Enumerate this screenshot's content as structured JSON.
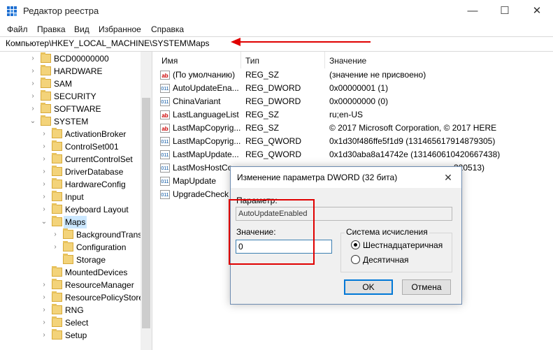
{
  "window": {
    "title": "Редактор реестра",
    "minimize": "—",
    "maximize": "☐",
    "close": "✕"
  },
  "menu": [
    "Файл",
    "Правка",
    "Вид",
    "Избранное",
    "Справка"
  ],
  "address": "Компьютер\\HKEY_LOCAL_MACHINE\\SYSTEM\\Maps",
  "colors": {
    "selection": "#cce8ff",
    "highlight": "#e00000",
    "folder": "#f3d37a"
  },
  "tree": [
    {
      "label": "BCD00000000"
    },
    {
      "label": "HARDWARE"
    },
    {
      "label": "SAM"
    },
    {
      "label": "SECURITY"
    },
    {
      "label": "SOFTWARE"
    },
    {
      "label": "SYSTEM"
    },
    {
      "label": "ActivationBroker"
    },
    {
      "label": "ControlSet001"
    },
    {
      "label": "CurrentControlSet"
    },
    {
      "label": "DriverDatabase"
    },
    {
      "label": "HardwareConfig"
    },
    {
      "label": "Input"
    },
    {
      "label": "Keyboard Layout"
    },
    {
      "label": "Maps"
    },
    {
      "label": "BackgroundTrans"
    },
    {
      "label": "Configuration"
    },
    {
      "label": "Storage"
    },
    {
      "label": "MountedDevices"
    },
    {
      "label": "ResourceManager"
    },
    {
      "label": "ResourcePolicyStore"
    },
    {
      "label": "RNG"
    },
    {
      "label": "Select"
    },
    {
      "label": "Setup"
    }
  ],
  "columns": {
    "name": "Имя",
    "type": "Тип",
    "data": "Значение"
  },
  "values": [
    {
      "name": "(По умолчанию)",
      "type": "REG_SZ",
      "data": "(значение не присвоено)",
      "icon": "ab"
    },
    {
      "name": "AutoUpdateEna...",
      "type": "REG_DWORD",
      "data": "0x00000001 (1)",
      "icon": "bin"
    },
    {
      "name": "ChinaVariant",
      "type": "REG_DWORD",
      "data": "0x00000000 (0)",
      "icon": "bin"
    },
    {
      "name": "LastLanguageList",
      "type": "REG_SZ",
      "data": "ru;en-US",
      "icon": "ab"
    },
    {
      "name": "LastMapCopyrig...",
      "type": "REG_SZ",
      "data": "© 2017 Microsoft Corporation, © 2017 HERE",
      "icon": "ab"
    },
    {
      "name": "LastMapCopyrig...",
      "type": "REG_QWORD",
      "data": "0x1d30f486ffe5f1d9 (131465617914879305)",
      "icon": "bin"
    },
    {
      "name": "LastMapUpdate...",
      "type": "REG_QWORD",
      "data": "0x1d30aba8a14742e (131460610420667438)",
      "icon": "bin"
    },
    {
      "name": "LastMosHostCo",
      "type": "",
      "data": "320513)",
      "icon": "bin"
    },
    {
      "name": "MapUpdate",
      "type": "",
      "data": "",
      "icon": "bin"
    },
    {
      "name": "UpgradeCheck",
      "type": "",
      "data": "",
      "icon": "bin"
    }
  ],
  "dialog": {
    "title": "Изменение параметра DWORD (32 бита)",
    "close": "✕",
    "param_label": "Параметр:",
    "param_value": "AutoUpdateEnabled",
    "value_label": "Значение:",
    "value": "0",
    "base_label": "Система исчисления",
    "hex_label": "Шестнадцатеричная",
    "dec_label": "Десятичная",
    "ok": "OK",
    "cancel": "Отмена"
  }
}
